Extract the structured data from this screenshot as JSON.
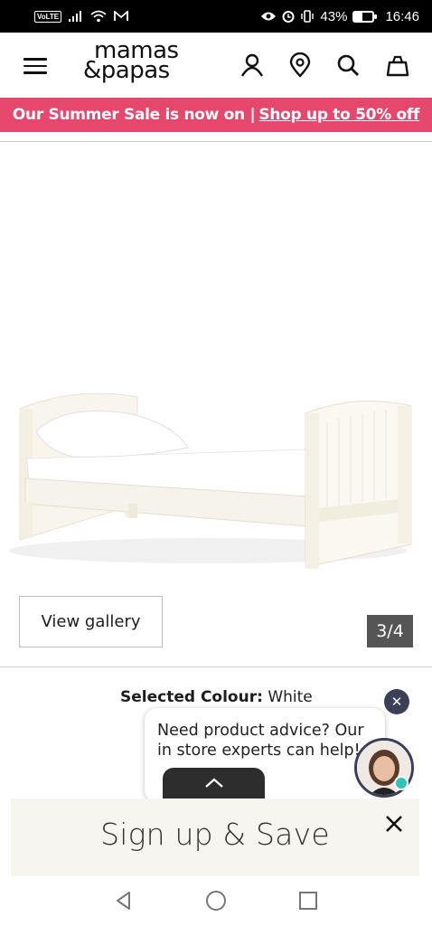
{
  "status_bar": {
    "volte": "VoLTE",
    "battery": "43%",
    "battery_level": 0.43,
    "time": "16:46"
  },
  "header": {
    "logo_line1": "mamas",
    "logo_line2": "&papas",
    "icons": [
      "menu-icon",
      "account-icon",
      "store-locator-icon",
      "search-icon",
      "bag-icon"
    ]
  },
  "promo": {
    "text": "Our Summer Sale is now on |",
    "link": "Shop up to 50% off",
    "color": "#e5476d"
  },
  "gallery": {
    "button_label": "View gallery",
    "counter": "3/4"
  },
  "product": {
    "colour_label": "Selected Colour:",
    "colour_value": "White"
  },
  "chat": {
    "message": "Need product advice? Our in store experts can help!",
    "close_symbol": "✕"
  },
  "signup": {
    "title": "Sign up & Save"
  },
  "nav": {
    "icons": [
      "back-icon",
      "home-icon",
      "recents-icon"
    ]
  }
}
